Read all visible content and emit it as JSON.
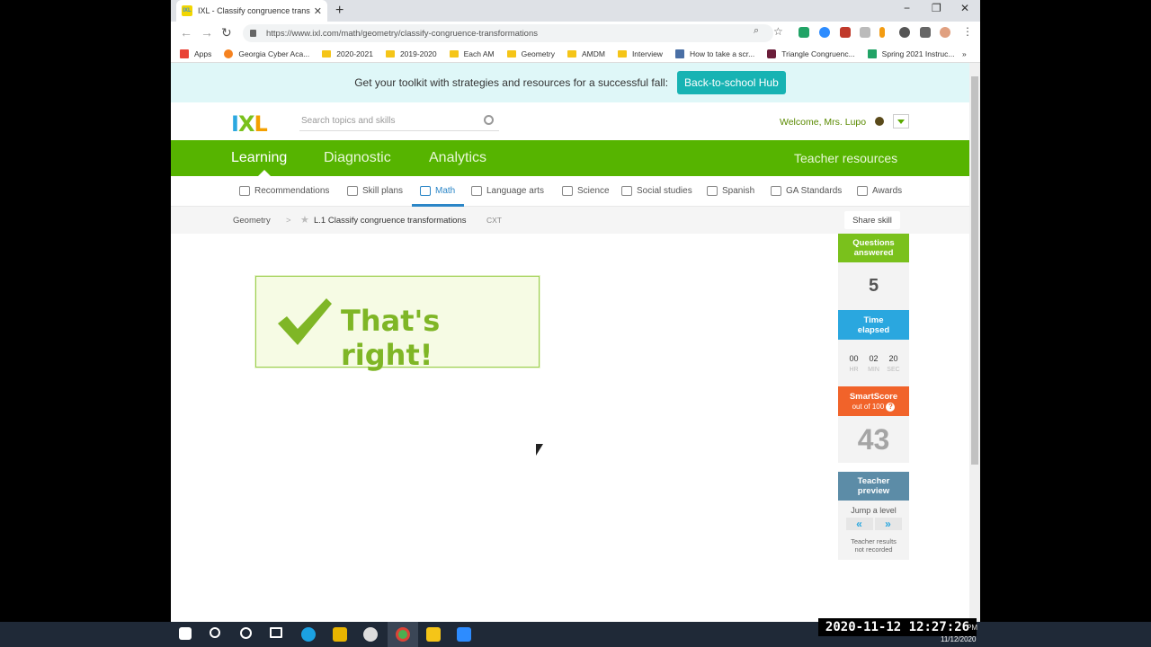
{
  "browser": {
    "tab_title": "IXL - Classify congruence transfo",
    "tab_close": "✕",
    "new_tab": "+",
    "win_min": "−",
    "win_max": "❐",
    "win_close": "✕",
    "url": "https://www.ixl.com/math/geometry/classify-congruence-transformations",
    "bookmarks": [
      "Apps",
      "Georgia Cyber Aca...",
      "2020-2021",
      "2019-2020",
      "Each AM",
      "Geometry",
      "AMDM",
      "Interview",
      "How to take a scr...",
      "Triangle Congruenc...",
      "Spring 2021 Instruc..."
    ],
    "bookmarks_more": "»"
  },
  "banner": {
    "text": "Get your toolkit with strategies and resources for a successful fall:",
    "button": "Back-to-school Hub"
  },
  "header": {
    "logo": [
      "I",
      "X",
      "L"
    ],
    "search_placeholder": "Search topics and skills",
    "welcome": "Welcome, Mrs. Lupo"
  },
  "main_nav": {
    "items": [
      "Learning",
      "Diagnostic",
      "Analytics"
    ],
    "teacher": "Teacher resources"
  },
  "subject_nav": [
    "Recommendations",
    "Skill plans",
    "Math",
    "Language arts",
    "Science",
    "Social studies",
    "Spanish",
    "GA Standards",
    "Awards"
  ],
  "breadcrumb": {
    "parent": "Geometry",
    "sep": ">",
    "skill": "L.1 Classify congruence transformations",
    "code": "CXT",
    "share": "Share skill"
  },
  "feedback": {
    "message": "That's right!"
  },
  "sidebar": {
    "questions_label": [
      "Questions",
      "answered"
    ],
    "questions_value": "5",
    "time_label": [
      "Time",
      "elapsed"
    ],
    "time": {
      "hr": "00",
      "min": "02",
      "sec": "20"
    },
    "time_units": {
      "hr": "HR",
      "min": "MIN",
      "sec": "SEC"
    },
    "smartscore_label": "SmartScore",
    "smartscore_sub": "out of 100",
    "smartscore_help": "?",
    "smartscore_value": "43",
    "preview_label": [
      "Teacher",
      "preview"
    ],
    "jump": "Jump a level",
    "prev": "«",
    "next": "»",
    "note": [
      "Teacher results",
      "not recorded"
    ]
  },
  "overlay": {
    "clock": "2020-11-12  12:27:26",
    "pm": "PM",
    "date": "11/12/2020"
  },
  "colors": {
    "ixl_green": "#56b400",
    "questions": "#7ac11c",
    "time": "#2aa7df",
    "smartscore": "#f1632a",
    "preview": "#5c8ca7"
  }
}
